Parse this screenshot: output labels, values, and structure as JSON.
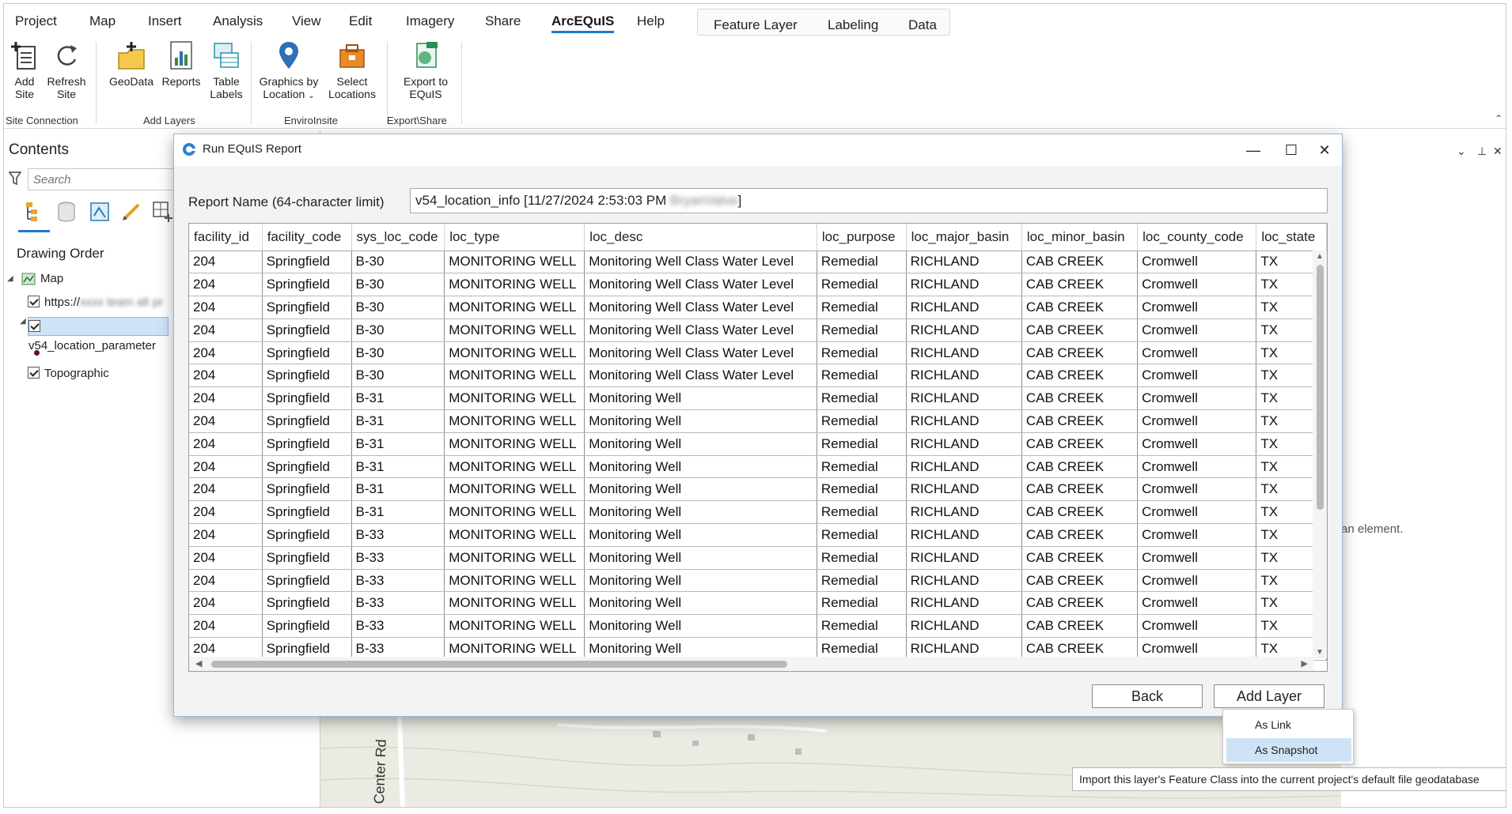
{
  "menubar": {
    "tabs": [
      "Project",
      "Map",
      "Insert",
      "Analysis",
      "View",
      "Edit",
      "Imagery",
      "Share",
      "ArcEQuIS",
      "Help"
    ],
    "active_tab": "ArcEQuIS",
    "context_tabs": [
      "Feature Layer",
      "Labeling",
      "Data"
    ]
  },
  "ribbon": {
    "add_site": "Add Site",
    "refresh_site": "Refresh Site",
    "geodata": "GeoData",
    "reports": "Reports",
    "table_labels": "Table Labels",
    "graphics_by_location": "Graphics by Location",
    "select_locations": "Select Locations",
    "export_to_equis": "Export to EQuIS",
    "groups": [
      "Site Connection",
      "Add Layers",
      "EnviroInsite",
      "Export\\Share"
    ]
  },
  "contents": {
    "title": "Contents",
    "search_placeholder": "Search",
    "drawing_order": "Drawing Order",
    "map_label": "Map",
    "service_label": "https://",
    "layer_label": "v54_location_parameter",
    "topographic_label": "Topographic"
  },
  "map": {
    "road_label": "Center Rd"
  },
  "right_pane": {
    "hint": "an element."
  },
  "dialog": {
    "title": "Run EQuIS Report",
    "report_name_label": "Report Name (64-character limit)",
    "report_name_value": "v54_location_info [11/27/2024 2:53:03 PM ",
    "report_name_suffix": "]",
    "back_label": "Back",
    "add_layer_label": "Add Layer"
  },
  "grid": {
    "columns": [
      "facility_id",
      "facility_code",
      "sys_loc_code",
      "loc_type",
      "loc_desc",
      "loc_purpose",
      "loc_major_basin",
      "loc_minor_basin",
      "loc_county_code",
      "loc_state"
    ],
    "rows": [
      [
        "204",
        "Springfield",
        "B-30",
        "MONITORING WELL",
        "Monitoring Well Class Water Level",
        "Remedial",
        "RICHLAND",
        "CAB CREEK",
        "Cromwell",
        "TX"
      ],
      [
        "204",
        "Springfield",
        "B-30",
        "MONITORING WELL",
        "Monitoring Well Class Water Level",
        "Remedial",
        "RICHLAND",
        "CAB CREEK",
        "Cromwell",
        "TX"
      ],
      [
        "204",
        "Springfield",
        "B-30",
        "MONITORING WELL",
        "Monitoring Well Class Water Level",
        "Remedial",
        "RICHLAND",
        "CAB CREEK",
        "Cromwell",
        "TX"
      ],
      [
        "204",
        "Springfield",
        "B-30",
        "MONITORING WELL",
        "Monitoring Well Class Water Level",
        "Remedial",
        "RICHLAND",
        "CAB CREEK",
        "Cromwell",
        "TX"
      ],
      [
        "204",
        "Springfield",
        "B-30",
        "MONITORING WELL",
        "Monitoring Well Class Water Level",
        "Remedial",
        "RICHLAND",
        "CAB CREEK",
        "Cromwell",
        "TX"
      ],
      [
        "204",
        "Springfield",
        "B-30",
        "MONITORING WELL",
        "Monitoring Well Class Water Level",
        "Remedial",
        "RICHLAND",
        "CAB CREEK",
        "Cromwell",
        "TX"
      ],
      [
        "204",
        "Springfield",
        "B-31",
        "MONITORING WELL",
        "Monitoring Well",
        "Remedial",
        "RICHLAND",
        "CAB CREEK",
        "Cromwell",
        "TX"
      ],
      [
        "204",
        "Springfield",
        "B-31",
        "MONITORING WELL",
        "Monitoring Well",
        "Remedial",
        "RICHLAND",
        "CAB CREEK",
        "Cromwell",
        "TX"
      ],
      [
        "204",
        "Springfield",
        "B-31",
        "MONITORING WELL",
        "Monitoring Well",
        "Remedial",
        "RICHLAND",
        "CAB CREEK",
        "Cromwell",
        "TX"
      ],
      [
        "204",
        "Springfield",
        "B-31",
        "MONITORING WELL",
        "Monitoring Well",
        "Remedial",
        "RICHLAND",
        "CAB CREEK",
        "Cromwell",
        "TX"
      ],
      [
        "204",
        "Springfield",
        "B-31",
        "MONITORING WELL",
        "Monitoring Well",
        "Remedial",
        "RICHLAND",
        "CAB CREEK",
        "Cromwell",
        "TX"
      ],
      [
        "204",
        "Springfield",
        "B-31",
        "MONITORING WELL",
        "Monitoring Well",
        "Remedial",
        "RICHLAND",
        "CAB CREEK",
        "Cromwell",
        "TX"
      ],
      [
        "204",
        "Springfield",
        "B-33",
        "MONITORING WELL",
        "Monitoring Well",
        "Remedial",
        "RICHLAND",
        "CAB CREEK",
        "Cromwell",
        "TX"
      ],
      [
        "204",
        "Springfield",
        "B-33",
        "MONITORING WELL",
        "Monitoring Well",
        "Remedial",
        "RICHLAND",
        "CAB CREEK",
        "Cromwell",
        "TX"
      ],
      [
        "204",
        "Springfield",
        "B-33",
        "MONITORING WELL",
        "Monitoring Well",
        "Remedial",
        "RICHLAND",
        "CAB CREEK",
        "Cromwell",
        "TX"
      ],
      [
        "204",
        "Springfield",
        "B-33",
        "MONITORING WELL",
        "Monitoring Well",
        "Remedial",
        "RICHLAND",
        "CAB CREEK",
        "Cromwell",
        "TX"
      ],
      [
        "204",
        "Springfield",
        "B-33",
        "MONITORING WELL",
        "Monitoring Well",
        "Remedial",
        "RICHLAND",
        "CAB CREEK",
        "Cromwell",
        "TX"
      ],
      [
        "204",
        "Springfield",
        "B-33",
        "MONITORING WELL",
        "Monitoring Well",
        "Remedial",
        "RICHLAND",
        "CAB CREEK",
        "Cromwell",
        "TX"
      ]
    ]
  },
  "dropdown": {
    "items": [
      "As Link",
      "As Snapshot"
    ],
    "highlighted": "As Snapshot"
  },
  "tooltip": "Import this layer's Feature Class into the current project's default file geodatabase",
  "colors": {
    "accent": "#1a7ad4",
    "selection": "#cfe3f7"
  }
}
